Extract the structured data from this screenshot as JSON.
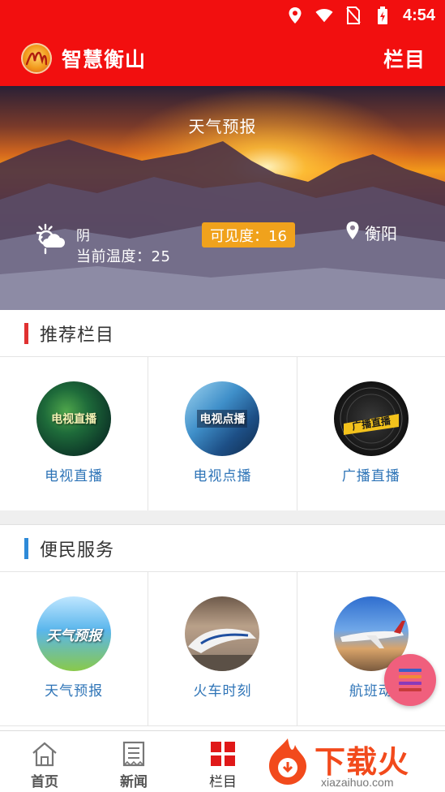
{
  "status_bar": {
    "time": "4:54"
  },
  "app_bar": {
    "title": "智慧衡山",
    "menu_label": "栏目"
  },
  "weather": {
    "title": "天气预报",
    "condition": "阴",
    "temperature": "当前温度：25",
    "visibility": "可见度：16",
    "location": "衡阳"
  },
  "sections": [
    {
      "title": "推荐栏目",
      "accent": "#e03131",
      "items": [
        {
          "label": "电视直播",
          "thumb_text": "电视直播",
          "icon": "tv-live-icon"
        },
        {
          "label": "电视点播",
          "thumb_text": "电视点播",
          "icon": "tv-vod-icon"
        },
        {
          "label": "广播直播",
          "thumb_text": "广播直播",
          "icon": "radio-live-icon"
        }
      ]
    },
    {
      "title": "便民服务",
      "accent": "#2e8ad8",
      "items": [
        {
          "label": "天气预报",
          "thumb_text": "天气预报",
          "icon": "weather-forecast-icon"
        },
        {
          "label": "火车时刻",
          "thumb_text": "",
          "icon": "train-icon"
        },
        {
          "label": "航班动",
          "thumb_text": "",
          "icon": "airplane-icon"
        }
      ]
    }
  ],
  "bottom_nav": [
    {
      "label": "首页",
      "icon": "home-icon"
    },
    {
      "label": "新闻",
      "icon": "news-icon"
    },
    {
      "label": "栏目",
      "icon": "grid-icon",
      "active": true
    }
  ],
  "watermark": {
    "text": "下载火",
    "sub": "xiazaihuo.com"
  },
  "colors": {
    "brand_red": "#f20f0f",
    "label_blue": "#2e74b7",
    "visibility_badge": "#f0a21c",
    "fab": "#f05f7d"
  }
}
